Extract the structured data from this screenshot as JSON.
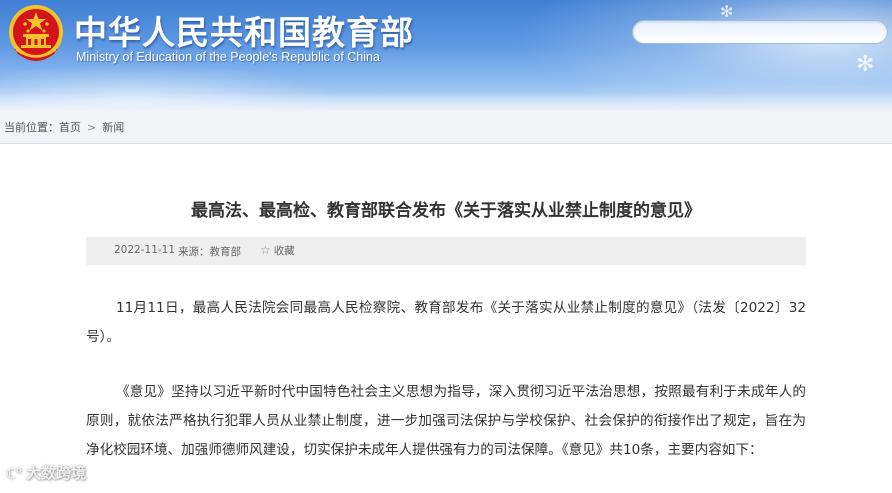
{
  "header": {
    "title": "中华人民共和国教育部",
    "subtitle": "Ministry of Education of the People's Republic of China",
    "search_placeholder": "",
    "emblem_icon": "national-emblem-icon",
    "colors": {
      "banner_top": "#3f7fd3",
      "banner_bottom": "#c9def7",
      "emblem_red": "#d3141b",
      "emblem_gold": "#f6c429"
    }
  },
  "breadcrumb": {
    "prefix": "当前位置：",
    "items": [
      "首页",
      "新闻"
    ],
    "separator": ">"
  },
  "article": {
    "title": "最高法、最高检、教育部联合发布《关于落实从业禁止制度的意见》",
    "date": "2022-11-11",
    "source": "来源：教育部",
    "favorite_label": "收藏",
    "paragraphs": [
      "11月11日，最高人民法院会同最高人民检察院、教育部发布《关于落实从业禁止制度的意见》（法发〔2022〕32号）。",
      "《意见》坚持以习近平新时代中国特色社会主义思想为指导，深入贯彻习近平法治思想，按照最有利于未成年人的原则，就依法严格执行犯罪人员从业禁止制度，进一步加强司法保护与学校保护、社会保护的衔接作出了规定，旨在为净化校园环境、加强师德师风建设，切实保护未成年人提供强有力的司法保障。《意见》共10条，主要内容如下："
    ]
  },
  "watermark": {
    "text": "大数跨境"
  }
}
